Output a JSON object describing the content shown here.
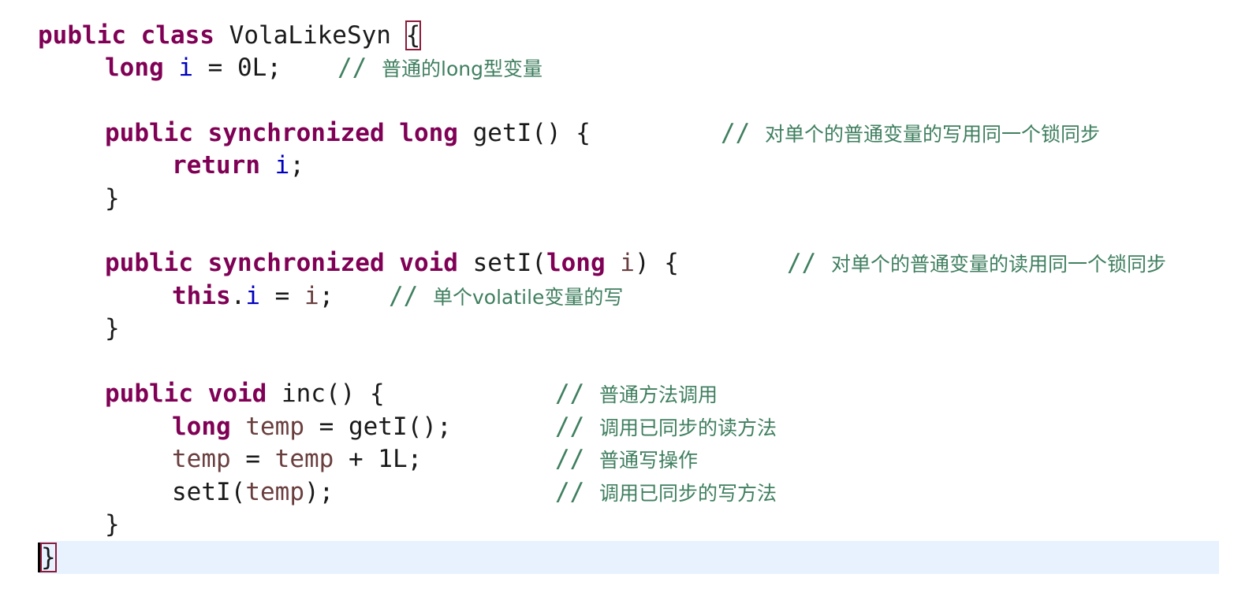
{
  "editor": {
    "class_decl": {
      "kw1": "public",
      "kw2": "class",
      "name": "VolaLikeSyn",
      "open_brace": "{"
    },
    "field_decl": {
      "type": "long",
      "name": "i",
      "rest": " = 0L;",
      "comment_slash": "//",
      "comment_text": "普通的long型变量"
    },
    "getter_decl": {
      "kw1": "public",
      "kw2": "synchronized",
      "type": "long",
      "sig": "getI() {",
      "comment_slash": "//",
      "comment_text": "对单个的普通变量的写用同一个锁同步"
    },
    "getter_body": {
      "kw": "return",
      "var": "i",
      "end": ";"
    },
    "getter_close": "}",
    "setter_decl": {
      "kw1": "public",
      "kw2": "synchronized",
      "type": "void",
      "sig_start": "setI(",
      "param_type": "long",
      "param_name": "i",
      "sig_end": ") {",
      "comment_slash": "//",
      "comment_text": "对单个的普通变量的读用同一个锁同步"
    },
    "setter_body": {
      "kw": "this",
      "dot": ".",
      "field": "i",
      "mid": " = ",
      "param": "i",
      "end": ";",
      "comment_slash": "//",
      "comment_text": "单个volatile变量的写"
    },
    "setter_close": "}",
    "inc_decl": {
      "kw1": "public",
      "kw2": "void",
      "sig": "inc() {",
      "comment_slash": "//",
      "comment_text": "普通方法调用"
    },
    "inc_line1": {
      "type": "long",
      "var": "temp",
      "rest": " = getI();",
      "comment_slash": "//",
      "comment_text": "调用已同步的读方法"
    },
    "inc_line2": {
      "var": "temp",
      "mid": " = ",
      "var2": "temp",
      "rest": " + 1L;",
      "comment_slash": "//",
      "comment_text": "普通写操作"
    },
    "inc_line3": {
      "start": "setI(",
      "var": "temp",
      "end": ");",
      "comment_slash": "//",
      "comment_text": "调用已同步的写方法"
    },
    "inc_close": "}",
    "class_close": "}"
  },
  "colors": {
    "keyword": "#7f0055",
    "field": "#0000c0",
    "local_variable": "#6a3e3e",
    "comment": "#3f7f5f",
    "current_line_highlight": "#e8f2fe",
    "bracket_match_box": "#8b1a3a"
  }
}
